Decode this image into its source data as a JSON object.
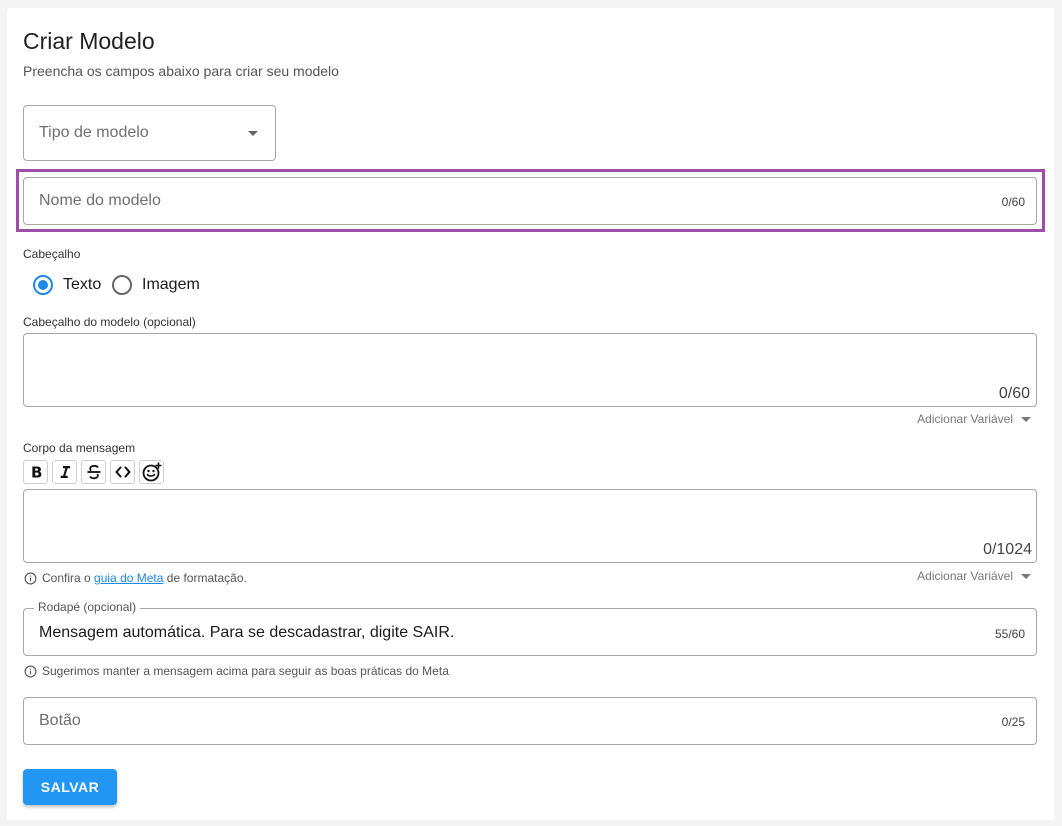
{
  "header": {
    "title": "Criar Modelo",
    "subtitle": "Preencha os campos abaixo para criar seu modelo"
  },
  "model_type": {
    "placeholder": "Tipo de modelo"
  },
  "model_name": {
    "placeholder": "Nome do modelo",
    "counter": "0/60"
  },
  "header_section": {
    "label": "Cabeçalho",
    "options": [
      {
        "label": "Texto",
        "selected": true
      },
      {
        "label": "Imagem",
        "selected": false
      }
    ],
    "field_label": "Cabeçalho do modelo (opcional)",
    "counter": "0/60",
    "add_variable": "Adicionar Variável"
  },
  "body_section": {
    "label": "Corpo da mensagem",
    "toolbar": [
      "bold-icon",
      "italic-icon",
      "strikethrough-icon",
      "code-icon",
      "emoji-add-icon"
    ],
    "counter": "0/1024",
    "info_prefix": "Confira o",
    "info_link": "guia do Meta",
    "info_suffix": "de formatação.",
    "add_variable": "Adicionar Variável"
  },
  "footer_section": {
    "legend": "Rodapé (opcional)",
    "value": "Mensagem automática. Para se descadastrar, digite SAIR.",
    "counter": "55/60",
    "info": "Sugerimos manter a mensagem acima para seguir as boas práticas do Meta"
  },
  "button_field": {
    "placeholder": "Botão",
    "counter": "0/25"
  },
  "actions": {
    "save_label": "SALVAR"
  },
  "colors": {
    "accent": "#2196f3",
    "highlight": "#9c4fa4",
    "radio_selected": "#1e88e5"
  }
}
